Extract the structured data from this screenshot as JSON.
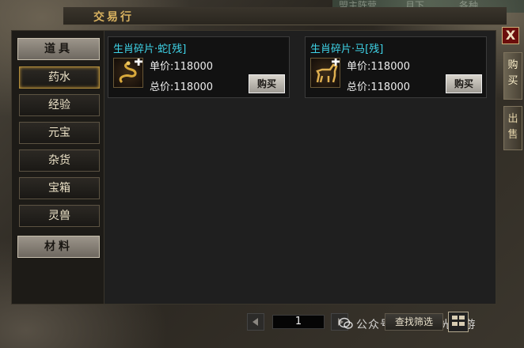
{
  "window": {
    "title": "交易行",
    "close_label": "X"
  },
  "scene": {
    "labels": [
      "盟主阵营",
      "月下",
      "各种"
    ]
  },
  "side_tabs": [
    {
      "label": "购买",
      "active": true
    },
    {
      "label": "出售",
      "active": false
    }
  ],
  "categories": {
    "main": [
      {
        "label": "道具"
      },
      {
        "label": "材料"
      }
    ],
    "sub": [
      {
        "label": "药水",
        "active": true
      },
      {
        "label": "经验",
        "active": false
      },
      {
        "label": "元宝",
        "active": false
      },
      {
        "label": "杂货",
        "active": false
      },
      {
        "label": "宝箱",
        "active": false
      },
      {
        "label": "灵兽",
        "active": false
      }
    ]
  },
  "listings": [
    {
      "name": "生肖碎片·蛇[残]",
      "unit_price_label": "单价:",
      "unit_price": "118000",
      "total_price_label": "总价:",
      "total_price": "118000",
      "buy_label": "购买",
      "icon": "snake-icon"
    },
    {
      "name": "生肖碎片·马[残]",
      "unit_price_label": "单价:",
      "unit_price": "118000",
      "total_price_label": "总价:",
      "total_price": "118000",
      "buy_label": "购买",
      "icon": "horse-icon"
    }
  ],
  "pager": {
    "page": "1",
    "filter_label": "查找筛选"
  },
  "watermark": {
    "text": "公众号 · 怀旧星光手游"
  },
  "colors": {
    "item_name": "#3fd4e8",
    "title": "#d9b260",
    "close_bg": "#6b0e0c"
  }
}
